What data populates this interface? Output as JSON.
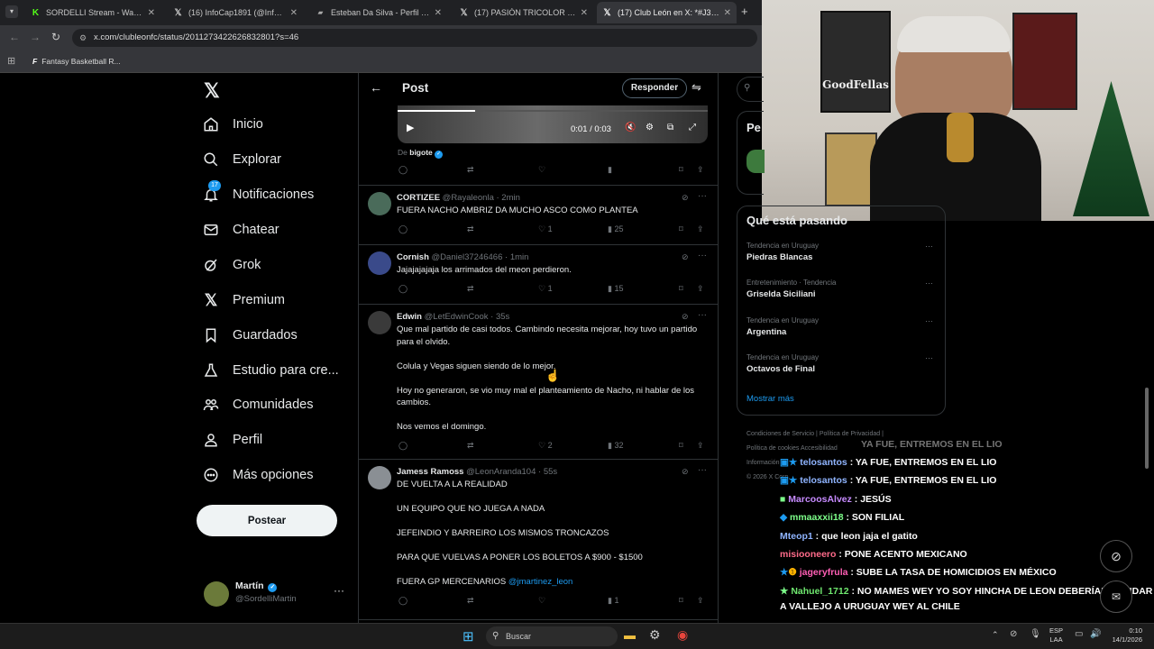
{
  "browser": {
    "tabs": [
      {
        "label": "SORDELLI Stream - Watch Live",
        "icon": "kick-icon",
        "color": "#53fc18"
      },
      {
        "label": "(16) InfoCap1891 (@InfoCap_18",
        "icon": "x-logo-icon",
        "color": "#ffffff"
      },
      {
        "label": "Esteban Da Silva - Perfil del jug",
        "icon": "site-icon",
        "color": "#ffffff"
      },
      {
        "label": "(17) PASIÓN TRICOLOR en X: \"¡",
        "icon": "x-logo-icon",
        "color": "#ffffff"
      },
      {
        "label": "(17) Club León en X: *#J3 | #CL",
        "icon": "x-logo-icon",
        "color": "#ffffff"
      }
    ],
    "url": "x.com/clubleonfc/status/2011273422626832801?s=46",
    "bookmark": "Fantasy Basketball R..."
  },
  "nav": {
    "items": [
      {
        "label": "Inicio",
        "icon": "home-icon"
      },
      {
        "label": "Explorar",
        "icon": "search-icon"
      },
      {
        "label": "Notificaciones",
        "icon": "bell-icon",
        "badge": "17"
      },
      {
        "label": "Chatear",
        "icon": "mail-icon"
      },
      {
        "label": "Grok",
        "icon": "grok-icon"
      },
      {
        "label": "Premium",
        "icon": "x-logo-icon"
      },
      {
        "label": "Guardados",
        "icon": "bookmark-icon"
      },
      {
        "label": "Estudio para cre...",
        "icon": "flask-icon"
      },
      {
        "label": "Comunidades",
        "icon": "people-icon"
      },
      {
        "label": "Perfil",
        "icon": "user-icon"
      },
      {
        "label": "Más opciones",
        "icon": "more-circle-icon"
      }
    ],
    "post_button": "Postear",
    "account": {
      "name": "Martín",
      "handle": "@SordelliMartin"
    }
  },
  "post_header": {
    "title": "Post",
    "reply_button": "Responder"
  },
  "video": {
    "time": "0:01 / 0:03",
    "credit_prefix": "De",
    "credit_name": "bigote"
  },
  "tweets": [
    {
      "name": "CORTIZEE",
      "handle": "@Rayaleonla · 2min",
      "text": "FUERA NACHO AMBRIZ DA MUCHO ASCO COMO PLANTEA",
      "likes": "1",
      "views": "25"
    },
    {
      "name": "Cornish",
      "handle": "@Daniel37246466 · 1min",
      "text": "Jajajajajaja los arrimados del meon perdieron.",
      "likes": "1",
      "views": "15"
    },
    {
      "name": "Edwin",
      "handle": "@LetEdwinCook · 35s",
      "text": "Que mal partido de casi todos. Cambindo necesita mejorar, hoy tuvo un partido para el olvido.\n\nColula y Vegas siguen siendo de lo mejor.\n\nHoy no generaron, se vio muy mal el planteamiento de Nacho, ni hablar de los cambios.\n\nNos vemos el domingo.",
      "likes": "2",
      "views": "32"
    },
    {
      "name": "Jamess Ramoss",
      "handle": "@LeonAranda104 · 55s",
      "text": "DE VUELTA A LA REALIDAD\n\nUN EQUIPO QUE NO JUEGA A NADA\n\nJEFEINDIO Y BARREIRO LOS MISMOS TRONCAZOS\n\nPARA QUE VUELVAS A PONER LOS BOLETOS A $900 - $1500\n\nFUERA GP MERCENARIOS ",
      "mention": "@jmartinez_leon",
      "likes": "",
      "views": "1"
    }
  ],
  "right": {
    "partial_heading": "Pe",
    "trends_title": "Qué está pasando",
    "trends": [
      {
        "context": "Tendencia en Uruguay",
        "name": "Piedras Blancas"
      },
      {
        "context": "Entretenimiento · Tendencia",
        "name": "Griselda Siciliani"
      },
      {
        "context": "Tendencia en Uruguay",
        "name": "Argentina"
      },
      {
        "context": "Tendencia en Uruguay",
        "name": "Octavos de Final"
      }
    ],
    "show_more": "Mostrar más",
    "footer": [
      "Condiciones de Servicio",
      "Política de Privacidad",
      "Política de cookies",
      "Accesibilidad",
      "Información",
      "© 2026 X Corp."
    ]
  },
  "chat": [
    {
      "user": "telosantos",
      "msg": " : YA FUE, ENTREMOS EN EL LIO",
      "color": "#8fb4ff"
    },
    {
      "user": "telosantos",
      "msg": " : YA FUE, ENTREMOS EN EL LIO",
      "color": "#8fb4ff"
    },
    {
      "user": "MarcoosAlvez",
      "msg": " : JESÚS",
      "color": "#c78bff"
    },
    {
      "user": "mmaaxxii18",
      "msg": " : SON FILIAL",
      "color": "#7dff8a"
    },
    {
      "user": "Mteop1",
      "msg": " : que leon jaja el gatito",
      "color": "#8fb4ff"
    },
    {
      "user": "misiooneero",
      "msg": " : PONE ACENTO MEXICANO",
      "color": "#ff6b8a"
    },
    {
      "user": "jageryfrula",
      "msg": " : SUBE LA TASA DE HOMICIDIOS EN MÉXICO",
      "color": "#ff5fb5"
    },
    {
      "user": "Nahuel_1712",
      "msg": " : NO MAMES WEY YO SOY HINCHA DE LEON DEBERÍAN MANDAR",
      "color": "#6fe86f"
    },
    {
      "user": "",
      "msg": "A VALLEJO A URUGUAY WEY AL CHILE",
      "color": "#ffffff"
    }
  ],
  "chat_ghost": "YA FUE, ENTREMOS EN EL LIO",
  "taskbar": {
    "search": "Buscar",
    "lang1": "ESP",
    "lang2": "LAA",
    "time": "0:10",
    "date": "14/1/2026"
  }
}
